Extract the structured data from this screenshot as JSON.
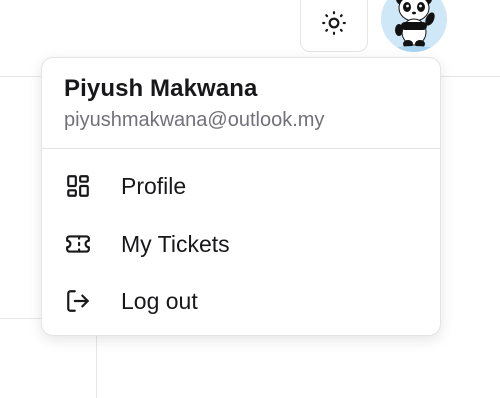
{
  "header": {
    "theme_toggle_icon": "sun-icon",
    "avatar_icon": "panda-avatar"
  },
  "menu": {
    "user_name": "Piyush Makwana",
    "user_email": "piyushmakwana@outlook.my",
    "items": [
      {
        "label": "Profile",
        "icon": "dashboard-grid-icon"
      },
      {
        "label": "My Tickets",
        "icon": "ticket-icon"
      },
      {
        "label": "Log out",
        "icon": "log-out-icon"
      }
    ]
  },
  "colors": {
    "text_primary": "#18181b",
    "text_muted": "#71717a",
    "border": "#e4e4e7",
    "avatar_bg": "#cfe8f7"
  }
}
